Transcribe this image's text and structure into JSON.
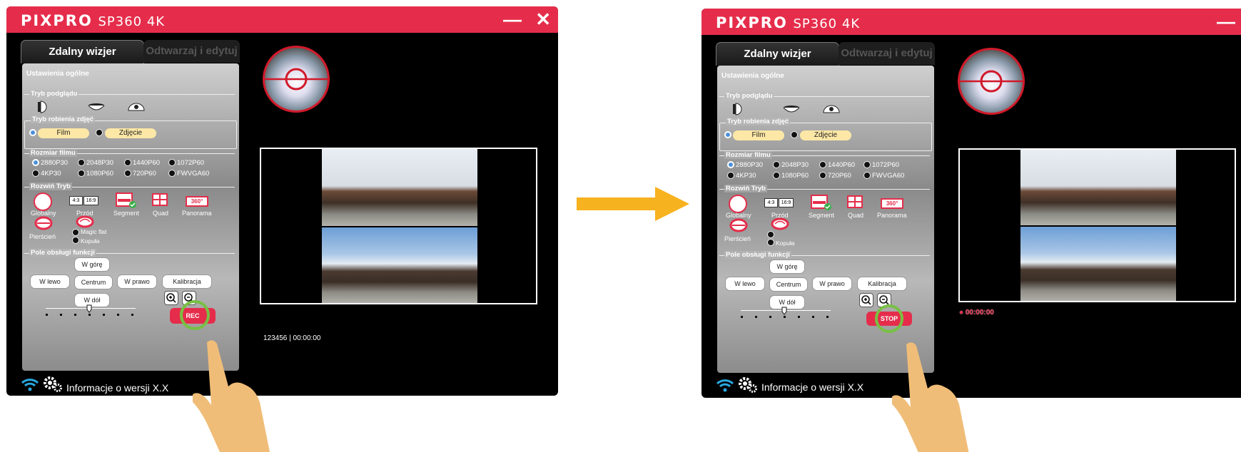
{
  "app": {
    "brand": "PIXPRO",
    "model": "SP360 4K",
    "minimize": "—",
    "close": "✕",
    "colors": {
      "titlebar": "#e52d4b",
      "accent_green": "#78c043",
      "arrow": "#f7b21f"
    }
  },
  "tabs": {
    "remote": "Zdalny wizjer",
    "playback": "Odtwarzaj i edytuj"
  },
  "panel": {
    "title": "Ustawienia ogólne",
    "preview_mode": {
      "label": "Tryb podglądu",
      "icons": [
        "half-sphere-icon",
        "ring-camera-icon",
        "dome-icon"
      ]
    },
    "shoot_mode": {
      "label": "Tryb robienia zdjęć",
      "film": "Film",
      "photo": "Zdjęcie",
      "selected": "Film"
    },
    "movie_size": {
      "label": "Rozmiar filmu",
      "options": [
        "2880P30",
        "2048P30",
        "1440P60",
        "1072P60",
        "4KP30",
        "1080P60",
        "720P60",
        "FWVGA60"
      ],
      "selected": "2880P30"
    },
    "expand_mode": {
      "label": "Rozwiń Tryb",
      "global": "Globalny",
      "front": "Przód",
      "front_ratio_a": "4:3",
      "front_ratio_b": "16:9",
      "segment": "Segment",
      "quad": "Quad",
      "panorama": "Panorama",
      "panorama_badge": "360°",
      "ring": "Pierścień",
      "magic_flat": "Magic flat",
      "dome": "Kopuła"
    },
    "control": {
      "label": "Pole obsługi funkcji",
      "up": "W górę",
      "left": "W lewo",
      "center": "Centrum",
      "right": "W prawo",
      "down": "W dół",
      "calibration": "Kalibracja"
    }
  },
  "screens": {
    "before": {
      "action_button": "REC",
      "timecode": "123456 | 00:00:00"
    },
    "after": {
      "action_button": "STOP",
      "rec_time": "● 00:00:00"
    }
  },
  "footer": {
    "version": "Informacje o wersji X.X"
  }
}
